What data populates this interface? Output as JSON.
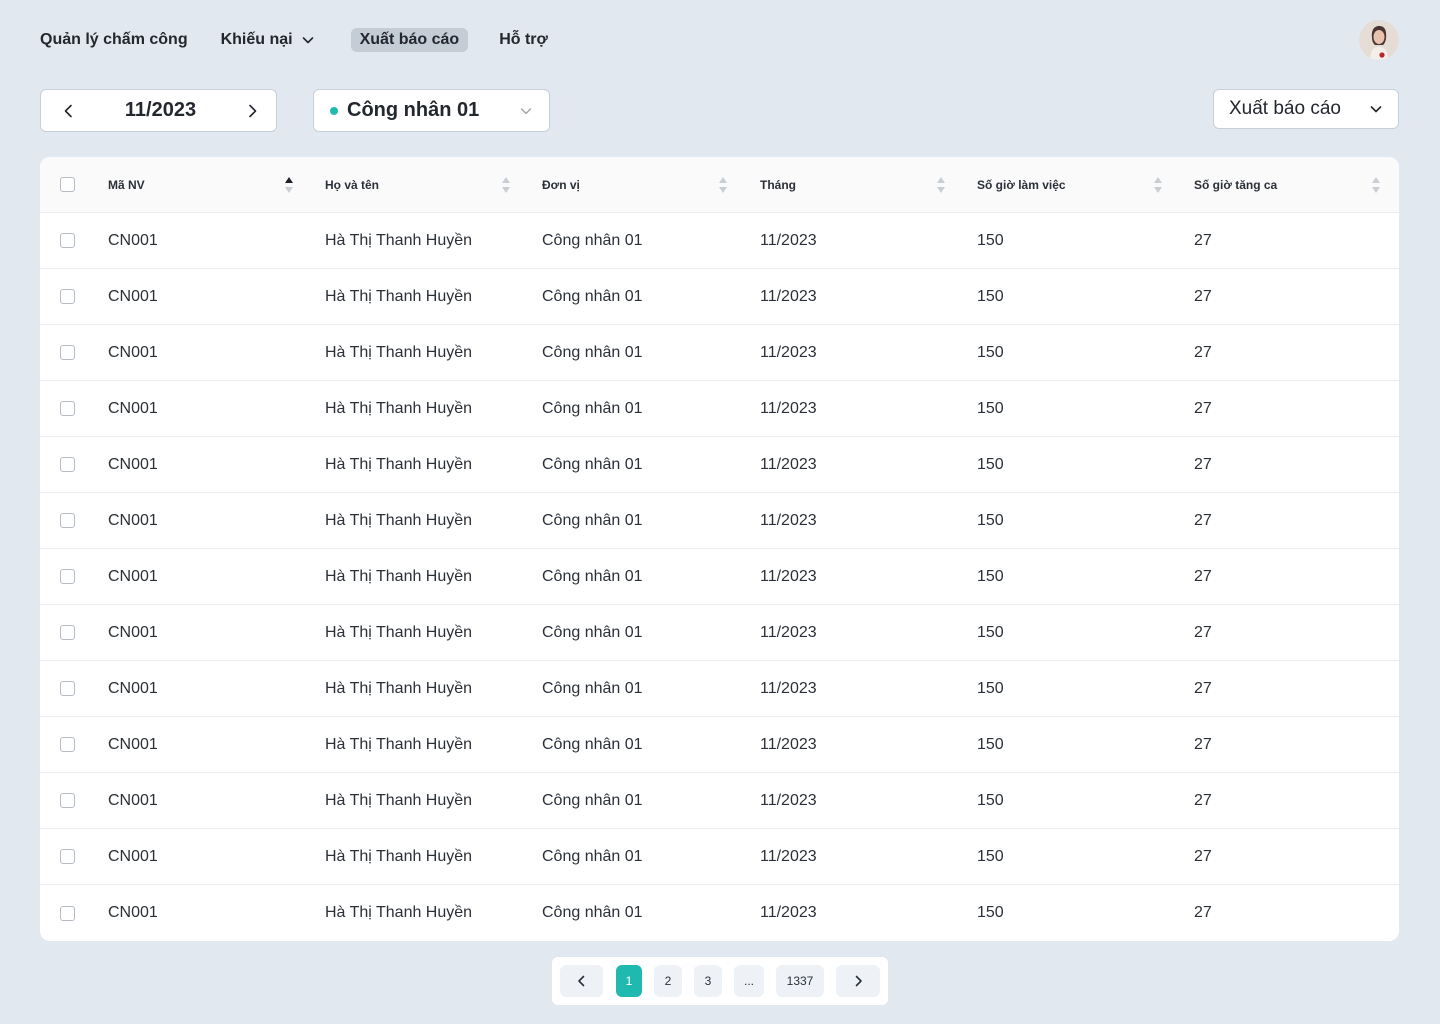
{
  "nav": {
    "items": [
      {
        "label": "Quản lý chấm công",
        "dropdown": false,
        "active": false
      },
      {
        "label": "Khiếu nại",
        "dropdown": true,
        "active": false
      },
      {
        "label": "Xuất báo cáo",
        "dropdown": false,
        "active": true
      },
      {
        "label": "Hỗ trợ",
        "dropdown": false,
        "active": false
      }
    ]
  },
  "filters": {
    "month": "11/2023",
    "unit": "Công nhân 01",
    "export_label": "Xuất báo cáo"
  },
  "colors": {
    "accent": "#1fb9b0",
    "background": "#e2e8ef",
    "active_nav": "#c4ccd6"
  },
  "table": {
    "columns": [
      "Mã NV",
      "Họ và tên",
      "Đơn vị",
      "Tháng",
      "Số giờ làm việc",
      "Số giờ tăng ca"
    ],
    "sorted_column": "Mã NV",
    "sort_direction": "ascending",
    "rows": [
      [
        "CN001",
        "Hà Thị Thanh Huyền",
        "Công nhân 01",
        "11/2023",
        "150",
        "27"
      ],
      [
        "CN001",
        "Hà Thị Thanh Huyền",
        "Công nhân 01",
        "11/2023",
        "150",
        "27"
      ],
      [
        "CN001",
        "Hà Thị Thanh Huyền",
        "Công nhân 01",
        "11/2023",
        "150",
        "27"
      ],
      [
        "CN001",
        "Hà Thị Thanh Huyền",
        "Công nhân 01",
        "11/2023",
        "150",
        "27"
      ],
      [
        "CN001",
        "Hà Thị Thanh Huyền",
        "Công nhân 01",
        "11/2023",
        "150",
        "27"
      ],
      [
        "CN001",
        "Hà Thị Thanh Huyền",
        "Công nhân 01",
        "11/2023",
        "150",
        "27"
      ],
      [
        "CN001",
        "Hà Thị Thanh Huyền",
        "Công nhân 01",
        "11/2023",
        "150",
        "27"
      ],
      [
        "CN001",
        "Hà Thị Thanh Huyền",
        "Công nhân 01",
        "11/2023",
        "150",
        "27"
      ],
      [
        "CN001",
        "Hà Thị Thanh Huyền",
        "Công nhân 01",
        "11/2023",
        "150",
        "27"
      ],
      [
        "CN001",
        "Hà Thị Thanh Huyền",
        "Công nhân 01",
        "11/2023",
        "150",
        "27"
      ],
      [
        "CN001",
        "Hà Thị Thanh Huyền",
        "Công nhân 01",
        "11/2023",
        "150",
        "27"
      ],
      [
        "CN001",
        "Hà Thị Thanh Huyền",
        "Công nhân 01",
        "11/2023",
        "150",
        "27"
      ],
      [
        "CN001",
        "Hà Thị Thanh Huyền",
        "Công nhân 01",
        "11/2023",
        "150",
        "27"
      ]
    ]
  },
  "pagination": {
    "pages": [
      "1",
      "2",
      "3",
      "...",
      "1337"
    ],
    "current": "1"
  },
  "icons": {
    "prev": "chevron-left-icon",
    "next": "chevron-right-icon",
    "dropdown": "chevron-down-icon",
    "sort": "sort-icon",
    "avatar": "user-avatar"
  }
}
